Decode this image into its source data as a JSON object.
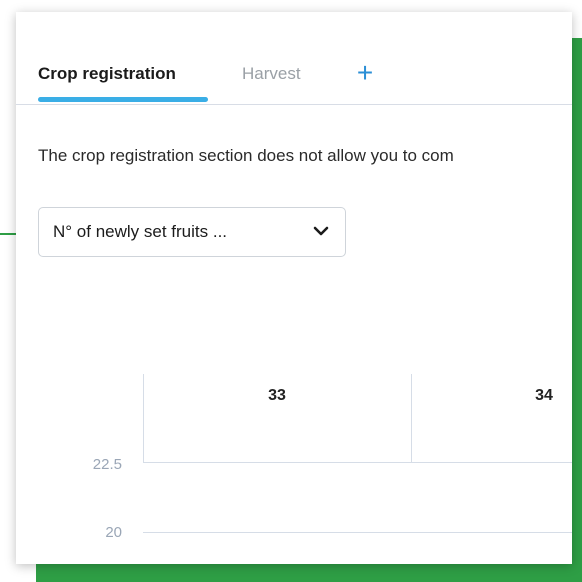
{
  "tabs": [
    {
      "label": "Crop registration",
      "active": true
    },
    {
      "label": "Harvest",
      "active": false
    }
  ],
  "add_tab_icon": "plus-icon",
  "description": "The crop registration section does not allow you to com",
  "dropdown": {
    "value": "N° of newly set fruits ...",
    "icon": "chevron-down-icon"
  },
  "chart": {
    "columns": [
      "33",
      "34"
    ],
    "y_ticks": [
      "22.5",
      "20"
    ]
  },
  "colors": {
    "accent_blue": "#3aaee6",
    "plus_blue": "#2b8fd6",
    "green_frame": "#2e9e45"
  }
}
